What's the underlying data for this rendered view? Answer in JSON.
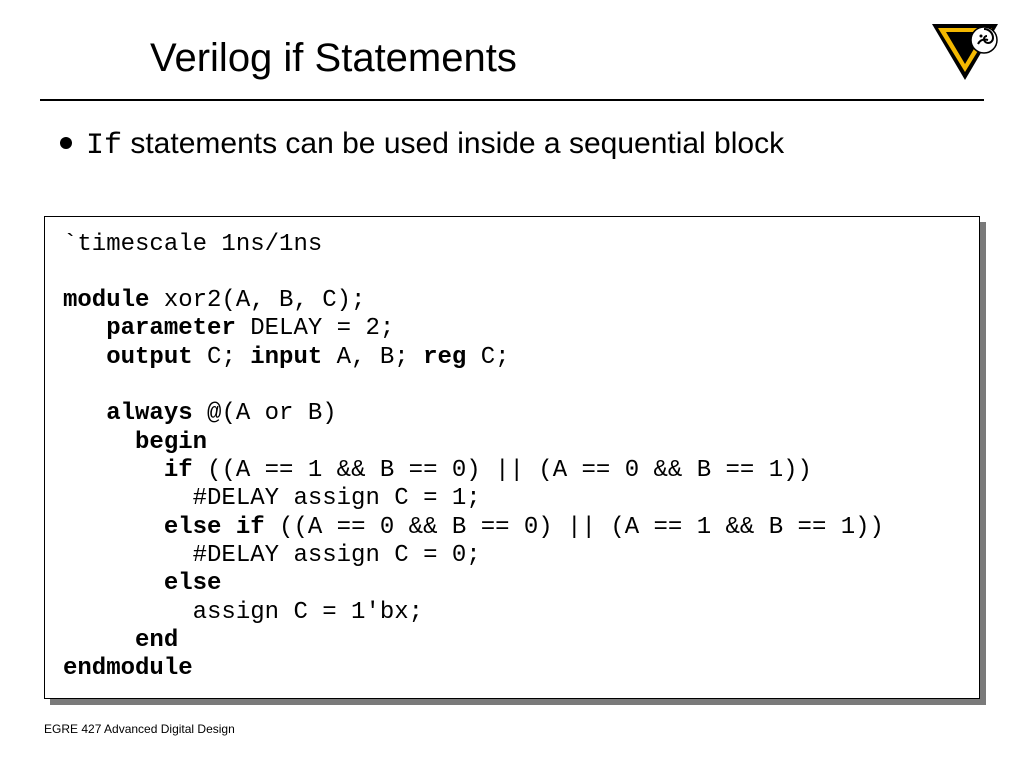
{
  "title": "Verilog if Statements",
  "bullet": {
    "mono": "If",
    "rest": " statements can be used inside a sequential block"
  },
  "code": {
    "l01a": "`timescale 1ns/1ns",
    "l02_blank": "",
    "l03_kw": "module",
    "l03_rest": " xor2(A, B, C);",
    "l04_kw": "parameter",
    "l04_rest": " DELAY = 2;",
    "l05_kw1": "output",
    "l05_mid1": " C; ",
    "l05_kw2": "input",
    "l05_mid2": " A, B; ",
    "l05_kw3": "reg",
    "l05_rest": " C;",
    "l06_blank": "",
    "l07_kw": "always",
    "l07_rest": " @(A or B)",
    "l08_kw": "begin",
    "l09_kw": "if",
    "l09_rest": " ((A == 1 && B == 0) || (A == 0 && B == 1))",
    "l10": "#DELAY assign C = 1;",
    "l11_kw": "else if",
    "l11_rest": " ((A == 0 && B == 0) || (A == 1 && B == 1))",
    "l12": "#DELAY assign C = 0;",
    "l13_kw": "else",
    "l14": "assign C = 1'bx;",
    "l15_kw": "end",
    "l16_kw": "endmodule"
  },
  "footer": "EGRE 427 Advanced Digital Design"
}
